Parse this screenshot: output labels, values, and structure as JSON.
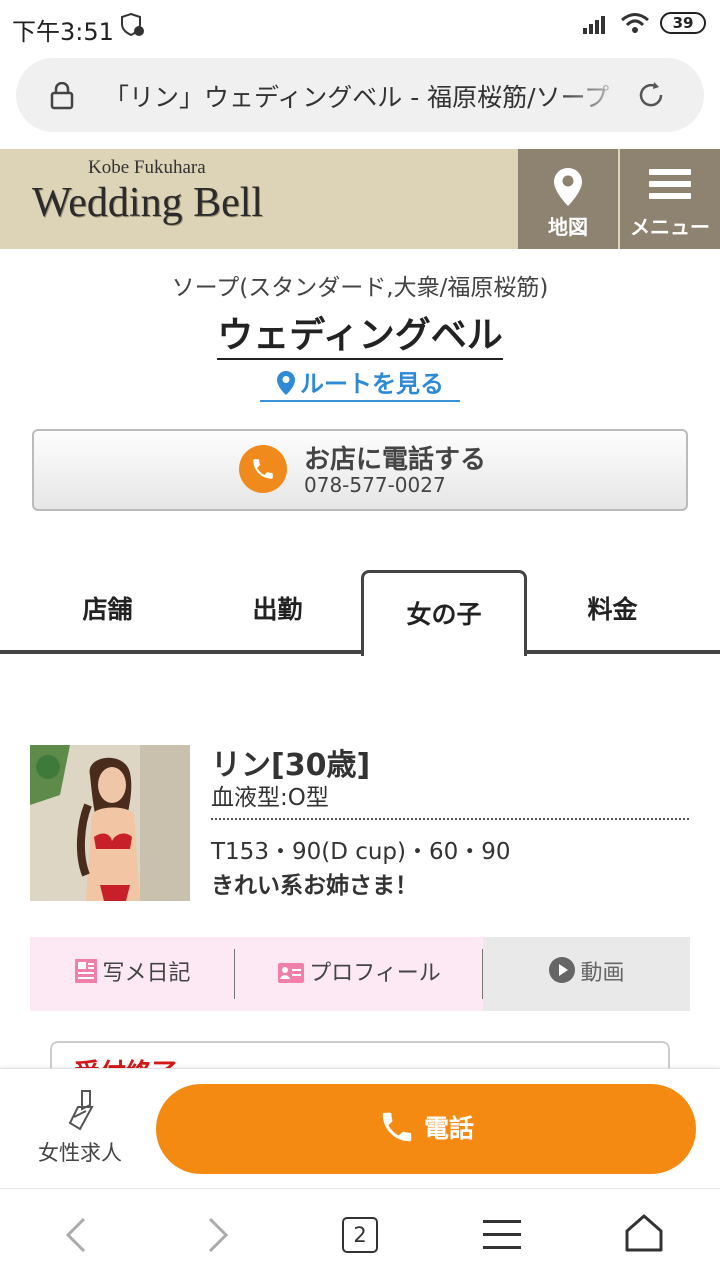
{
  "status_bar": {
    "time": "下午3:51",
    "battery": "39"
  },
  "browser": {
    "url_text": "「リン」ウェディングベル - 福原桜筋/ソープ",
    "tab_count": "2"
  },
  "header": {
    "logo_sub": "Kobe Fukuhara",
    "logo_main": "Wedding Bell",
    "map_label": "地図",
    "menu_label": "メニュー"
  },
  "shop": {
    "category": "ソープ(スタンダード,大衆/福原桜筋)",
    "name": "ウェディングベル",
    "route_label": "ルートを見る",
    "call_title": "お店に電話する",
    "call_number": "078-577-0027"
  },
  "tabs": [
    "店舗",
    "出勤",
    "女の子",
    "料金"
  ],
  "active_tab": "女の子",
  "profile": {
    "name": "リン[30歳]",
    "blood": "血液型:O型",
    "size": "T153・90(D cup)・60・90",
    "catch": "きれい系お姉さま！"
  },
  "links": {
    "diary": "写メ日記",
    "profile": "プロフィール",
    "video": "動画"
  },
  "status_box": "受付終了",
  "bottom": {
    "recruit": "女性求人",
    "call": "電話"
  },
  "colors": {
    "accent_orange": "#f48a12",
    "header_bg": "#ddd3b7",
    "header_btn": "#8e8270",
    "link_blue": "#2f8ad5"
  }
}
